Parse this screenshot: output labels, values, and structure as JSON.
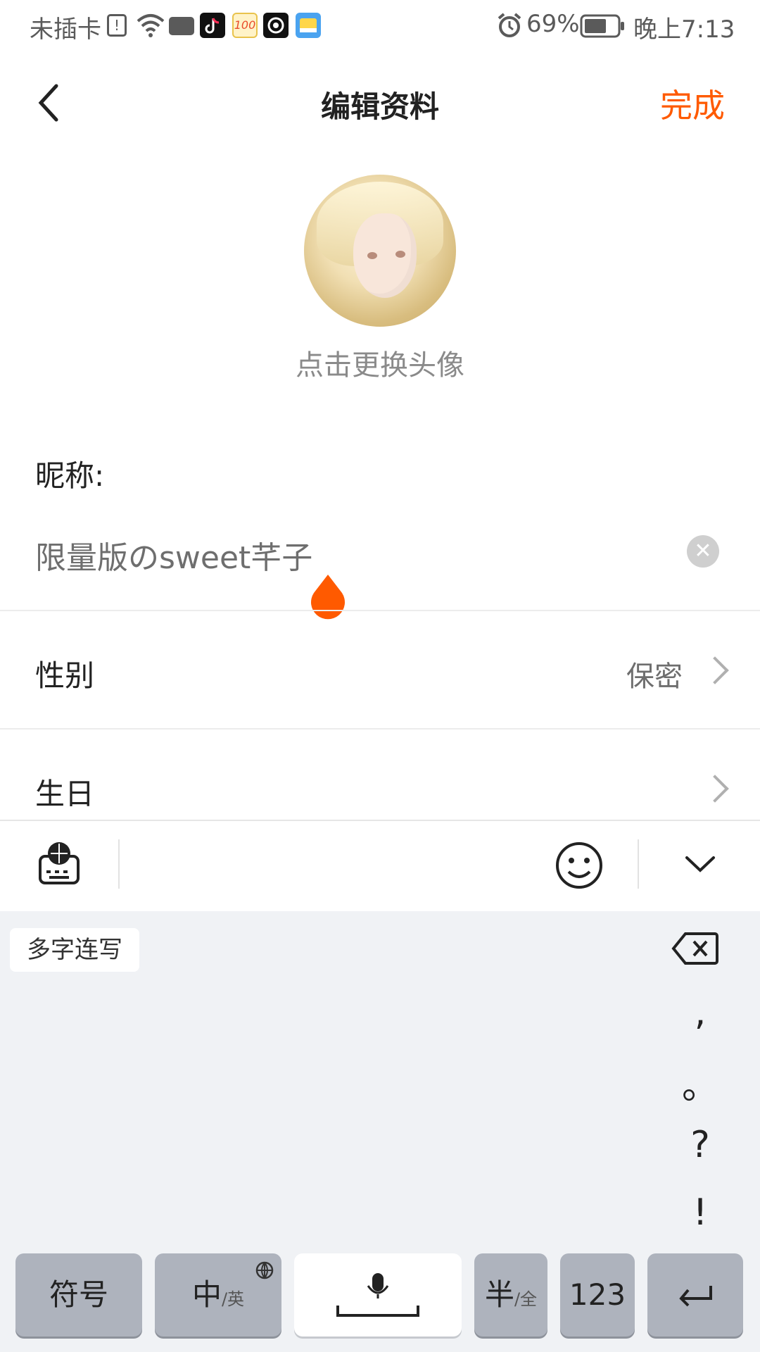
{
  "status_bar": {
    "carrier": "未插卡",
    "battery": "69%",
    "time": "晚上7:13"
  },
  "header": {
    "title": "编辑资料",
    "done_label": "完成"
  },
  "avatar": {
    "tip": "点击更换头像"
  },
  "form": {
    "nickname_label": "昵称:",
    "nickname_value": "限量版のsweet芊子",
    "gender_label": "性别",
    "gender_value": "保密",
    "birthday_label": "生日"
  },
  "keyboard": {
    "chip": "多字连写",
    "punctuation": [
      ",",
      "。",
      "?",
      "!"
    ],
    "keys": {
      "symbol": "符号",
      "zh_main": "中",
      "zh_sub": "/英",
      "half_main": "半",
      "half_sub": "/全",
      "num": "123"
    }
  },
  "colors": {
    "accent": "#ff5a00",
    "keyboard_bg": "#f0f2f5",
    "key_gray": "#aeb3bd"
  }
}
